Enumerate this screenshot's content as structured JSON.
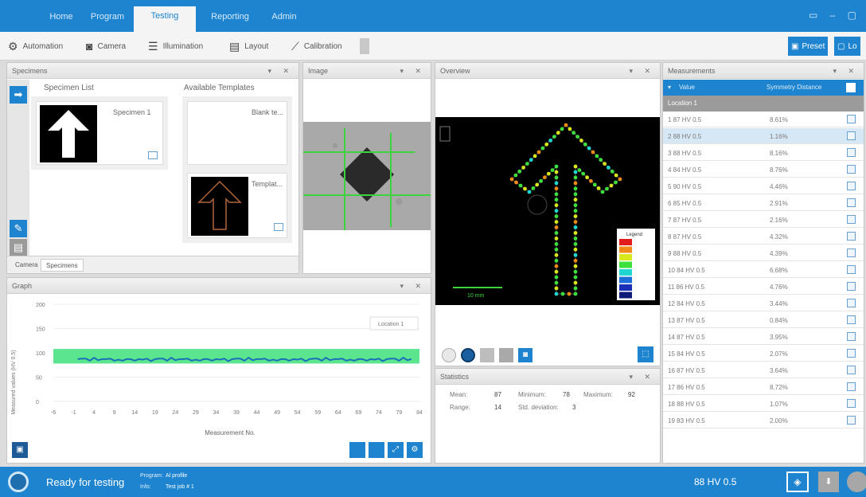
{
  "nav": {
    "tabs": [
      "Home",
      "Program",
      "Testing",
      "Reporting",
      "Admin"
    ],
    "active": "Testing"
  },
  "toolbar": {
    "items": [
      "Automation",
      "Camera",
      "Illumination",
      "Layout",
      "Calibration"
    ],
    "right_buttons": [
      "Preset",
      "Lo"
    ]
  },
  "specimens": {
    "title": "Specimens",
    "list_title": "Specimen List",
    "templates_title": "Available Templates",
    "specimen_name": "Specimen 1",
    "blank_name": "Blank te...",
    "template_name": "Templat...",
    "tabs": [
      "Camera",
      "Specimens"
    ]
  },
  "image": {
    "title": "Image"
  },
  "overview": {
    "title": "Overview",
    "scale_label": "10 mm",
    "legend_title": "Legend",
    "legend_colors": [
      "#e31b1b",
      "#f08a18",
      "#d8e61c",
      "#3ee03e",
      "#20d6d0",
      "#1d6fd8",
      "#1a2fb8",
      "#101a78"
    ]
  },
  "graph": {
    "title": "Graph",
    "legend": "Location 1",
    "xlabel": "Measurement No.",
    "ylabel": "Measured values (HV 0.5)",
    "yticks": [
      "200",
      "150",
      "100",
      "50",
      "0"
    ],
    "xticks": [
      "-6",
      "-1",
      "4",
      "9",
      "14",
      "19",
      "24",
      "29",
      "34",
      "39",
      "44",
      "49",
      "54",
      "59",
      "64",
      "69",
      "74",
      "79",
      "84"
    ]
  },
  "statistics": {
    "title": "Statistics",
    "mean_label": "Mean:",
    "mean": "87",
    "min_label": "Minimum:",
    "min": "78",
    "max_label": "Maximum:",
    "max": "92",
    "range_label": "Range:",
    "range": "14",
    "std_label": "Std. deviation:",
    "std": "3"
  },
  "measurements": {
    "title": "Measurements",
    "col_value": "Value",
    "col_sym": "Symmetry Distance",
    "group": "Location 1",
    "selected_index": 1,
    "rows": [
      {
        "value": "1  87 HV 0.5",
        "sym": "8.61%"
      },
      {
        "value": "2  88 HV 0.5",
        "sym": "1.16%"
      },
      {
        "value": "3  88 HV 0.5",
        "sym": "8.16%"
      },
      {
        "value": "4  84 HV 0.5",
        "sym": "8.76%"
      },
      {
        "value": "5  90 HV 0.5",
        "sym": "4.46%"
      },
      {
        "value": "6  85 HV 0.5",
        "sym": "2.91%"
      },
      {
        "value": "7  87 HV 0.5",
        "sym": "2.16%"
      },
      {
        "value": "8  87 HV 0.5",
        "sym": "4.32%"
      },
      {
        "value": "9  88 HV 0.5",
        "sym": "4.39%"
      },
      {
        "value": "10  84 HV 0.5",
        "sym": "6.68%"
      },
      {
        "value": "11  86 HV 0.5",
        "sym": "4.76%"
      },
      {
        "value": "12  84 HV 0.5",
        "sym": "3.44%"
      },
      {
        "value": "13  87 HV 0.5",
        "sym": "0.84%"
      },
      {
        "value": "14  87 HV 0.5",
        "sym": "3.95%"
      },
      {
        "value": "15  84 HV 0.5",
        "sym": "2.07%"
      },
      {
        "value": "16  87 HV 0.5",
        "sym": "3.64%"
      },
      {
        "value": "17  86 HV 0.5",
        "sym": "8.72%"
      },
      {
        "value": "18  88 HV 0.5",
        "sym": "1.07%"
      },
      {
        "value": "19  83 HV 0.5",
        "sym": "2.00%"
      }
    ]
  },
  "status": {
    "text": "Ready for testing",
    "program_label": "Program:",
    "program": "Al profile",
    "info_label": "Info:",
    "info": "Test job # 1",
    "reading": "88 HV 0.5"
  }
}
